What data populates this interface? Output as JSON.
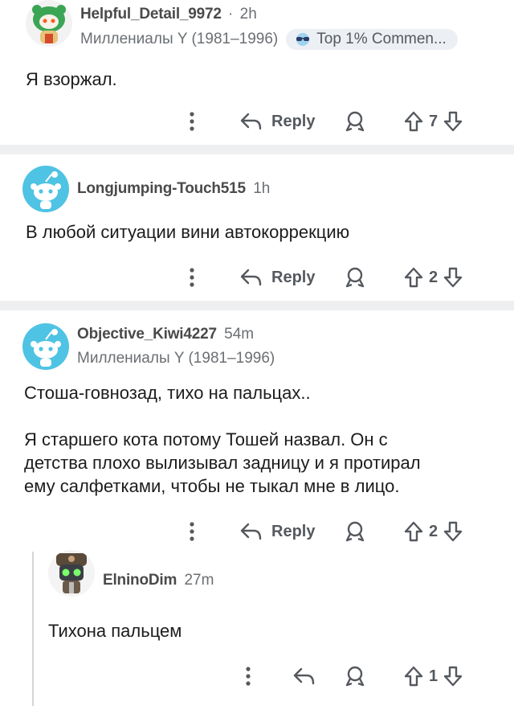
{
  "comments": [
    {
      "username": "Helpful_Detail_9972",
      "separator": "·",
      "time": "2h",
      "flair": "Миллениалы Y (1981–1996)",
      "badge": "Top 1% Commen...",
      "badge_icon": "sunglasses-icon",
      "body": [
        "Я взоржал."
      ],
      "reply_label": "Reply",
      "score": "7"
    },
    {
      "username": "Longjumping-Touch515",
      "time": "1h",
      "body": [
        "В любой ситуации вини автокоррекцию"
      ],
      "reply_label": "Reply",
      "score": "2"
    },
    {
      "username": "Objective_Kiwi4227",
      "time": "54m",
      "flair": "Миллениалы Y (1981–1996)",
      "body": [
        "Стоша-говнозад, тихо на пальцах..",
        "",
        "Я старшего кота потому Тошей назвал. Он с",
        "детства плохо вылизывал задницу и я протирал",
        "ему салфетками, чтобы не тыкал мне в лицо."
      ],
      "reply_label": "Reply",
      "score": "2"
    },
    {
      "username": "ElninoDim",
      "time": "27m",
      "body": [
        "Тихона пальцем"
      ],
      "score": "1"
    }
  ],
  "colors": {
    "separator": "#edeff1",
    "default_avatar": "#4fc3e3",
    "icon_gray": "#55595e",
    "thread_line": "#d3d6da"
  }
}
